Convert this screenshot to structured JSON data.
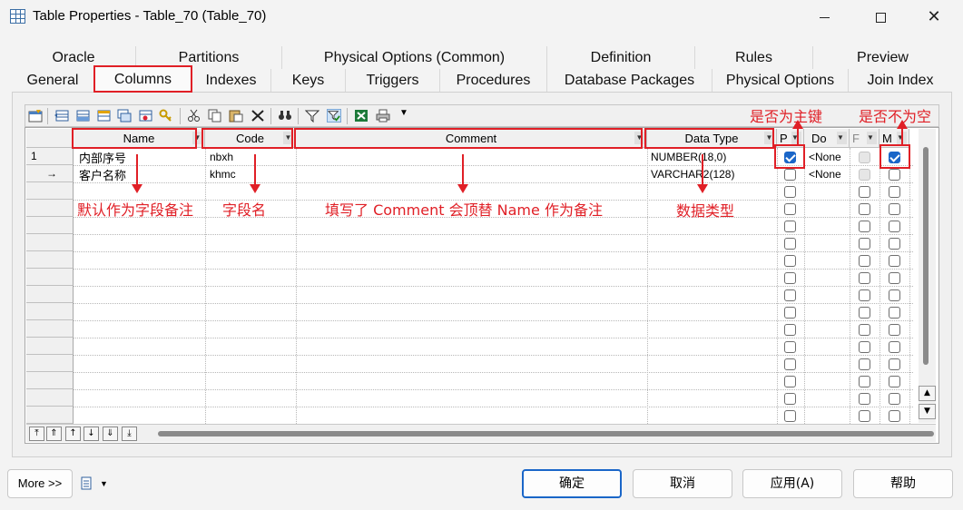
{
  "window": {
    "title": "Table Properties - Table_70 (Table_70)"
  },
  "tabs_row1": [
    "Oracle",
    "Partitions",
    "Physical Options (Common)",
    "Definition",
    "Rules",
    "Preview"
  ],
  "tabs_row2": [
    "General",
    "Columns",
    "Indexes",
    "Keys",
    "Triggers",
    "Procedures",
    "Database Packages",
    "Physical Options",
    "Join Index"
  ],
  "active_tab": "Columns",
  "grid": {
    "headers": {
      "name": "Name",
      "code": "Code",
      "comment": "Comment",
      "data_type": "Data Type",
      "primary": "P",
      "domain": "Do",
      "foreign": "F",
      "mandatory": "M"
    },
    "rows": [
      {
        "row_label": "1",
        "name": "内部序号",
        "code": "nbxh",
        "comment": "",
        "data_type": "NUMBER(18,0)",
        "primary": true,
        "domain": "<None",
        "foreign": false,
        "mandatory": true
      },
      {
        "row_label": "→",
        "name": "客户名称",
        "code": "khmc",
        "comment": "",
        "data_type": "VARCHAR2(128)",
        "primary": false,
        "domain": "<None",
        "foreign": false,
        "mandatory": false
      }
    ]
  },
  "annotations": {
    "name": "默认作为字段备注",
    "code": "字段名",
    "comment": "填写了 Comment 会顶替 Name 作为备注",
    "data_type": "数据类型",
    "primary": "是否为主键",
    "mandatory": "是否不为空"
  },
  "footer": {
    "more": "More >>",
    "ok": "确定",
    "cancel": "取消",
    "apply": "应用(A)",
    "help": "帮助"
  },
  "colors": {
    "annotation_red": "#e01f26",
    "check_blue": "#1a66c8"
  }
}
